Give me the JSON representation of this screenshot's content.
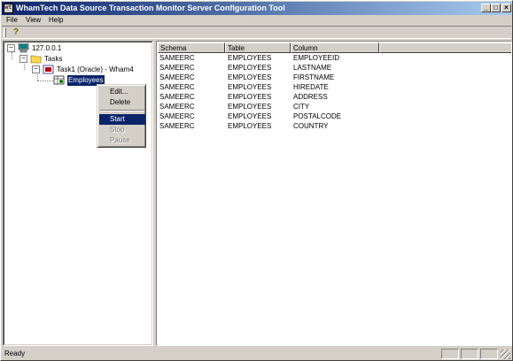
{
  "window": {
    "title": "WhamTech Data Source Transaction Monitor Server Configuration Tool",
    "title_icon": "wt"
  },
  "menu": {
    "file": "File",
    "view": "View",
    "help": "Help"
  },
  "toolbar": {
    "help_icon": "help-question-icon"
  },
  "tree": {
    "server": "127.0.0.1",
    "tasks": "Tasks",
    "task1": "Task1 (Oracle) - Wham4",
    "employees": "Employees"
  },
  "context_menu": {
    "edit": "Edit...",
    "delete": "Delete",
    "start": "Start",
    "stop": "Stop",
    "pause": "Pause"
  },
  "table": {
    "headers": [
      "Schema",
      "Table",
      "Column"
    ],
    "rows": [
      [
        "SAMEERC",
        "EMPLOYEES",
        "EMPLOYEEID"
      ],
      [
        "SAMEERC",
        "EMPLOYEES",
        "LASTNAME"
      ],
      [
        "SAMEERC",
        "EMPLOYEES",
        "FIRSTNAME"
      ],
      [
        "SAMEERC",
        "EMPLOYEES",
        "HIREDATE"
      ],
      [
        "SAMEERC",
        "EMPLOYEES",
        "ADDRESS"
      ],
      [
        "SAMEERC",
        "EMPLOYEES",
        "CITY"
      ],
      [
        "SAMEERC",
        "EMPLOYEES",
        "POSTALCODE"
      ],
      [
        "SAMEERC",
        "EMPLOYEES",
        "COUNTRY"
      ]
    ]
  },
  "status": {
    "text": "Ready"
  },
  "colors": {
    "titlebar_start": "#0a246a",
    "titlebar_end": "#a6caf0",
    "selection": "#0a246a",
    "face": "#d4d0c8"
  }
}
